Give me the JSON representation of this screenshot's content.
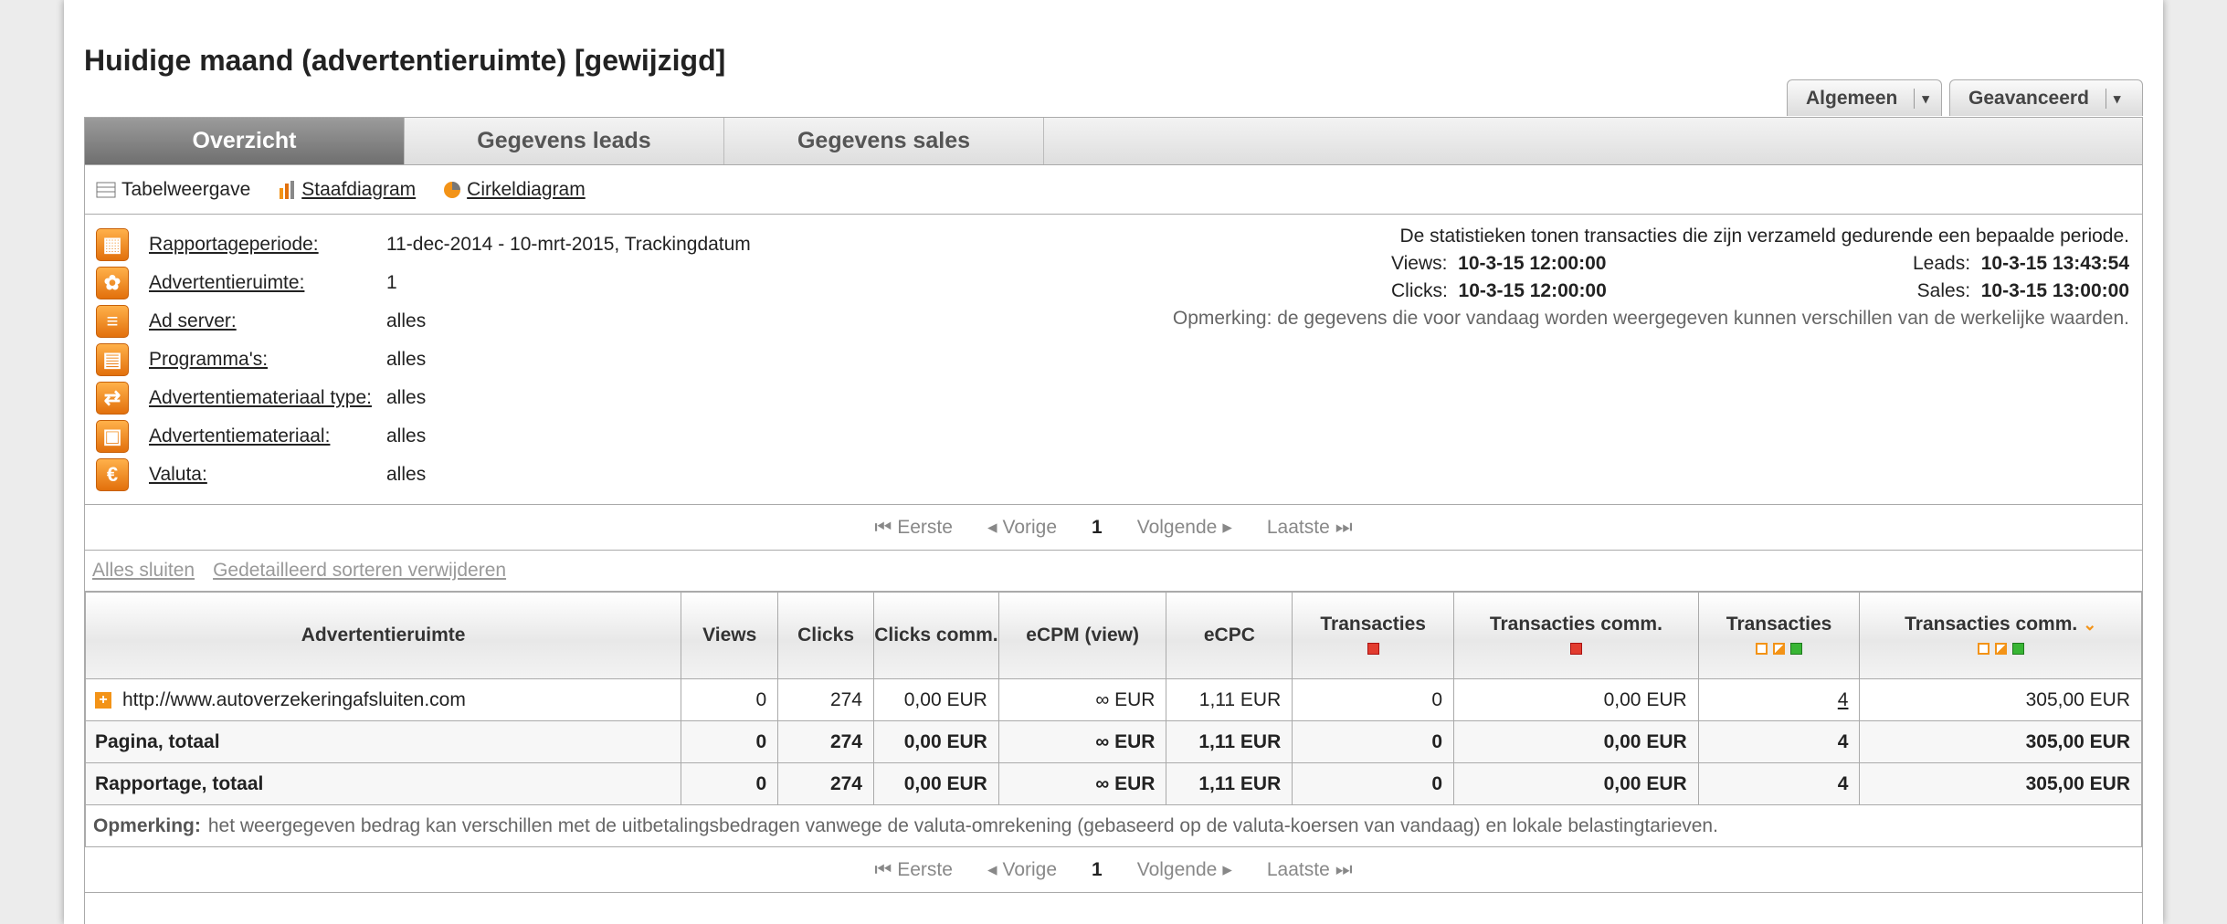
{
  "page_title": "Huidige maand (advertentieruimte) [gewijzigd]",
  "top_buttons": [
    {
      "label": "Algemeen",
      "icon": "chevron-down-icon"
    },
    {
      "label": "Geavanceerd",
      "icon": "chevron-down-icon"
    }
  ],
  "tabs": [
    {
      "label": "Overzicht",
      "active": true
    },
    {
      "label": "Gegevens leads",
      "active": false
    },
    {
      "label": "Gegevens sales",
      "active": false
    }
  ],
  "views": {
    "table": "Tabelweergave",
    "bar": "Staafdiagram",
    "pie": "Cirkeldiagram"
  },
  "filters": [
    {
      "label": "Rapportageperiode:",
      "value": "11-dec-2014 - 10-mrt-2015, Trackingdatum",
      "icon": "calendar-icon"
    },
    {
      "label": "Advertentieruimte:",
      "value": "1",
      "icon": "network-icon"
    },
    {
      "label": "Ad server:",
      "value": "alles",
      "icon": "server-icon"
    },
    {
      "label": "Programma's:",
      "value": "alles",
      "icon": "grid-icon"
    },
    {
      "label": "Advertentiemateriaal type:",
      "value": "alles",
      "icon": "material-type-icon"
    },
    {
      "label": "Advertentiemateriaal:",
      "value": "alles",
      "icon": "material-icon"
    },
    {
      "label": "Valuta:",
      "value": "alles",
      "icon": "euro-icon"
    }
  ],
  "stats": {
    "intro": "De statistieken tonen transacties die zijn verzameld gedurende een bepaalde periode.",
    "views_label": "Views:",
    "views_value": "10-3-15 12:00:00",
    "clicks_label": "Clicks:",
    "clicks_value": "10-3-15 12:00:00",
    "leads_label": "Leads:",
    "leads_value": "10-3-15 13:43:54",
    "sales_label": "Sales:",
    "sales_value": "10-3-15 13:00:00",
    "note": "Opmerking: de gegevens die voor vandaag worden weergegeven kunnen verschillen van de werkelijke waarden."
  },
  "pager": {
    "first": "Eerste",
    "prev": "Vorige",
    "current": "1",
    "next": "Volgende",
    "last": "Laatste"
  },
  "actions": {
    "close_all": "Alles sluiten",
    "remove_sort": "Gedetailleerd sorteren verwijderen"
  },
  "table": {
    "headers": [
      "Advertentieruimte",
      "Views",
      "Clicks",
      "Clicks comm.",
      "eCPM (view)",
      "eCPC",
      "Transacties",
      "Transacties comm.",
      "Transacties",
      "Transacties comm."
    ],
    "rows": [
      {
        "name": "http://www.autoverzekeringafsluiten.com",
        "views": "0",
        "clicks": "274",
        "clicks_comm": "0,00 EUR",
        "ecpm": "∞ EUR",
        "ecpc": "1,11 EUR",
        "trans_open": "0",
        "trans_open_comm": "0,00 EUR",
        "trans": "4",
        "trans_comm": "305,00 EUR"
      }
    ],
    "page_total": {
      "name": "Pagina, totaal",
      "views": "0",
      "clicks": "274",
      "clicks_comm": "0,00 EUR",
      "ecpm": "∞ EUR",
      "ecpc": "1,11 EUR",
      "trans_open": "0",
      "trans_open_comm": "0,00 EUR",
      "trans": "4",
      "trans_comm": "305,00 EUR"
    },
    "report_total": {
      "name": "Rapportage, totaal",
      "views": "0",
      "clicks": "274",
      "clicks_comm": "0,00 EUR",
      "ecpm": "∞ EUR",
      "ecpc": "1,11 EUR",
      "trans_open": "0",
      "trans_open_comm": "0,00 EUR",
      "trans": "4",
      "trans_comm": "305,00 EUR"
    }
  },
  "remark": {
    "label": "Opmerking:",
    "text": "het weergegeven bedrag kan verschillen met de uitbetalingsbedragen vanwege de valuta-omrekening (gebaseerd op de valuta-koersen van vandaag) en lokale belastingtarieven."
  },
  "colors": {
    "accent": "#f39317",
    "red": "#e23c2f",
    "green": "#38b534",
    "tab_active": "#7f7f7f"
  }
}
